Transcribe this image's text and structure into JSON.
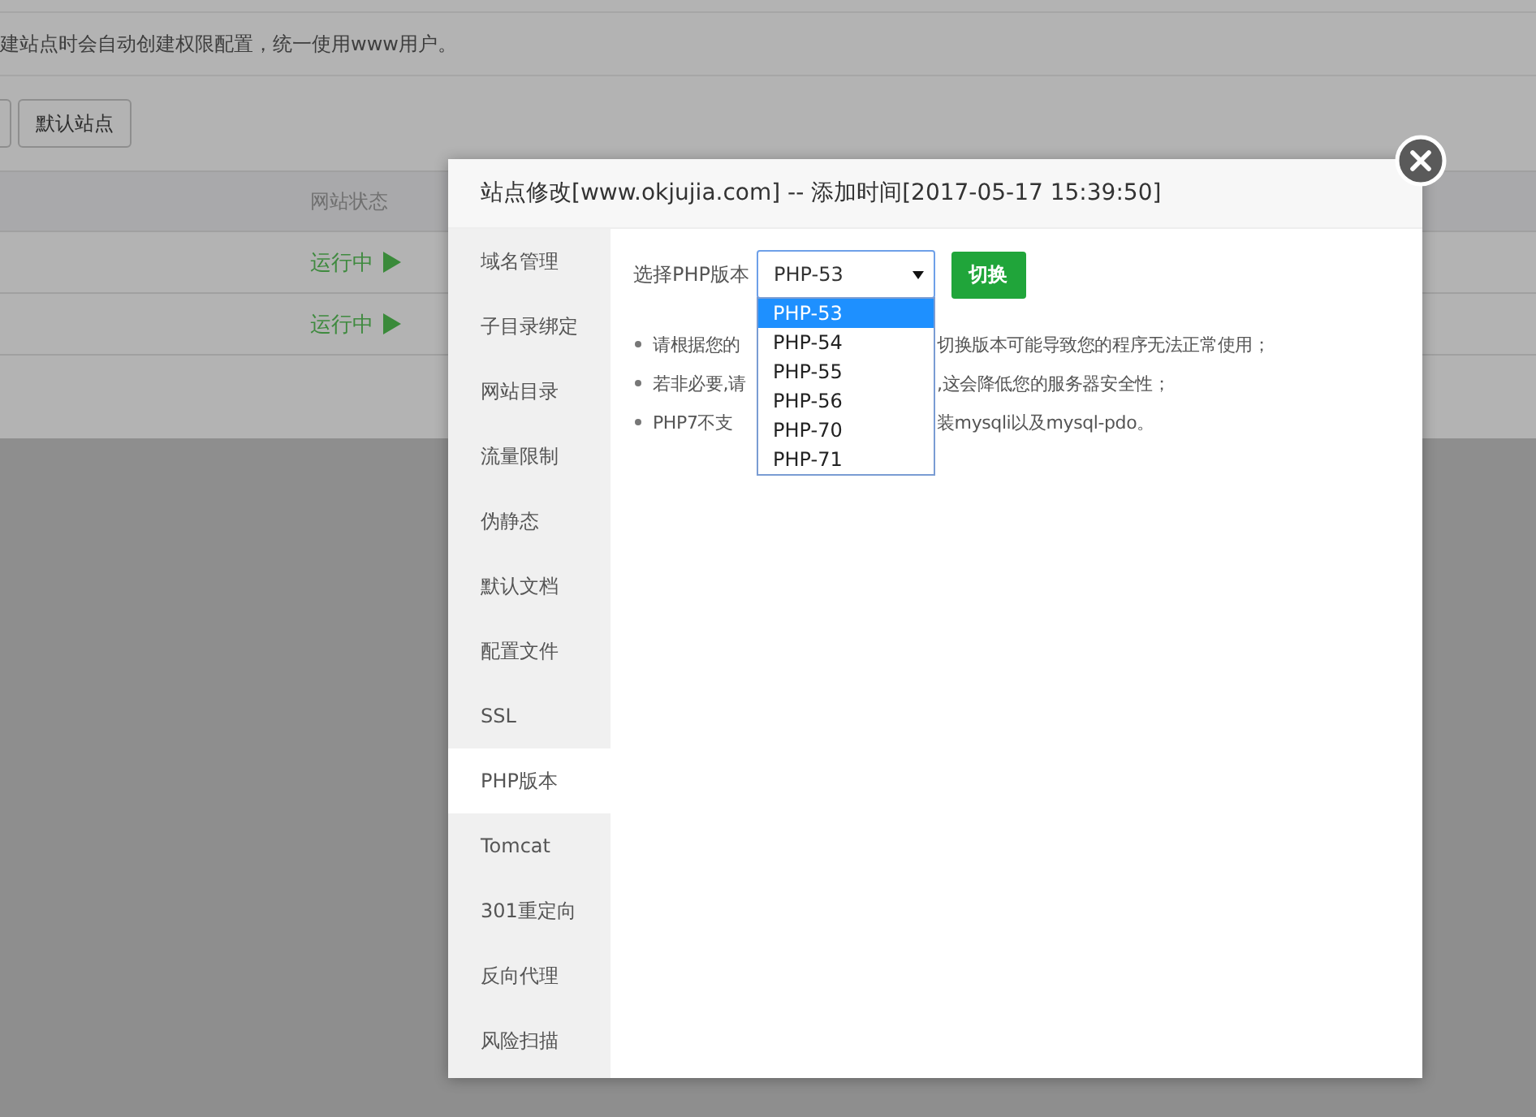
{
  "background": {
    "notice": "建站点时会自动创建权限配置，统一使用www用户。",
    "buttons": [
      {
        "label": "默认站点"
      }
    ],
    "table": {
      "columns": [
        "网站状态"
      ],
      "rows": [
        {
          "status": "运行中"
        },
        {
          "status": "运行中"
        }
      ]
    }
  },
  "dialog": {
    "title": "站点修改[www.okjujia.com] -- 添加时间[2017-05-17 15:39:50]",
    "sidebar": {
      "items": [
        {
          "label": "域名管理",
          "selected": false
        },
        {
          "label": "子目录绑定",
          "selected": false
        },
        {
          "label": "网站目录",
          "selected": false
        },
        {
          "label": "流量限制",
          "selected": false
        },
        {
          "label": "伪静态",
          "selected": false
        },
        {
          "label": "默认文档",
          "selected": false
        },
        {
          "label": "配置文件",
          "selected": false
        },
        {
          "label": "SSL",
          "selected": false
        },
        {
          "label": "PHP版本",
          "selected": true
        },
        {
          "label": "Tomcat",
          "selected": false
        },
        {
          "label": "301重定向",
          "selected": false
        },
        {
          "label": "反向代理",
          "selected": false
        },
        {
          "label": "风险扫描",
          "selected": false
        }
      ]
    },
    "php_label": "选择PHP版本",
    "select": {
      "value": "PHP-53",
      "options": [
        {
          "label": "PHP-53",
          "selected": true
        },
        {
          "label": "PHP-54",
          "selected": false
        },
        {
          "label": "PHP-55",
          "selected": false
        },
        {
          "label": "PHP-56",
          "selected": false
        },
        {
          "label": "PHP-70",
          "selected": false
        },
        {
          "label": "PHP-71",
          "selected": false
        }
      ]
    },
    "switch_button": "切换",
    "notes": [
      {
        "before": "请根据您的",
        "after": "切换版本可能导致您的程序无法正常使用；"
      },
      {
        "before": "若非必要,请",
        "after": ",这会降低您的服务器安全性；"
      },
      {
        "before": "PHP7不支",
        "after": "装mysqli以及mysql-pdo。"
      }
    ]
  }
}
